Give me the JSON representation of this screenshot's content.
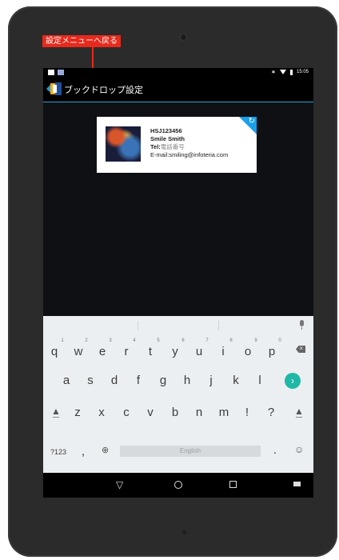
{
  "callout": {
    "label": "設定メニューへ戻る"
  },
  "status_bar": {
    "time": "15:05"
  },
  "app_bar": {
    "title": "ブックドロップ設定"
  },
  "card": {
    "id": "HSJ123456",
    "name": "Smile Smith",
    "tel_label": "Tel:",
    "tel_value": "電話番号",
    "email": "E-mail:smiling@infoteria.com"
  },
  "keyboard": {
    "row1": [
      "q",
      "w",
      "e",
      "r",
      "t",
      "y",
      "u",
      "i",
      "o",
      "p"
    ],
    "row1_hints": [
      "1",
      "2",
      "3",
      "4",
      "5",
      "6",
      "7",
      "8",
      "9",
      "0"
    ],
    "row2": [
      "a",
      "s",
      "d",
      "f",
      "g",
      "h",
      "j",
      "k",
      "l"
    ],
    "row3": [
      "z",
      "x",
      "c",
      "v",
      "b",
      "n",
      "m",
      "!",
      "?"
    ],
    "symbols_label": "?123",
    "comma_label": ",",
    "period_label": ".",
    "space_label": "English"
  }
}
